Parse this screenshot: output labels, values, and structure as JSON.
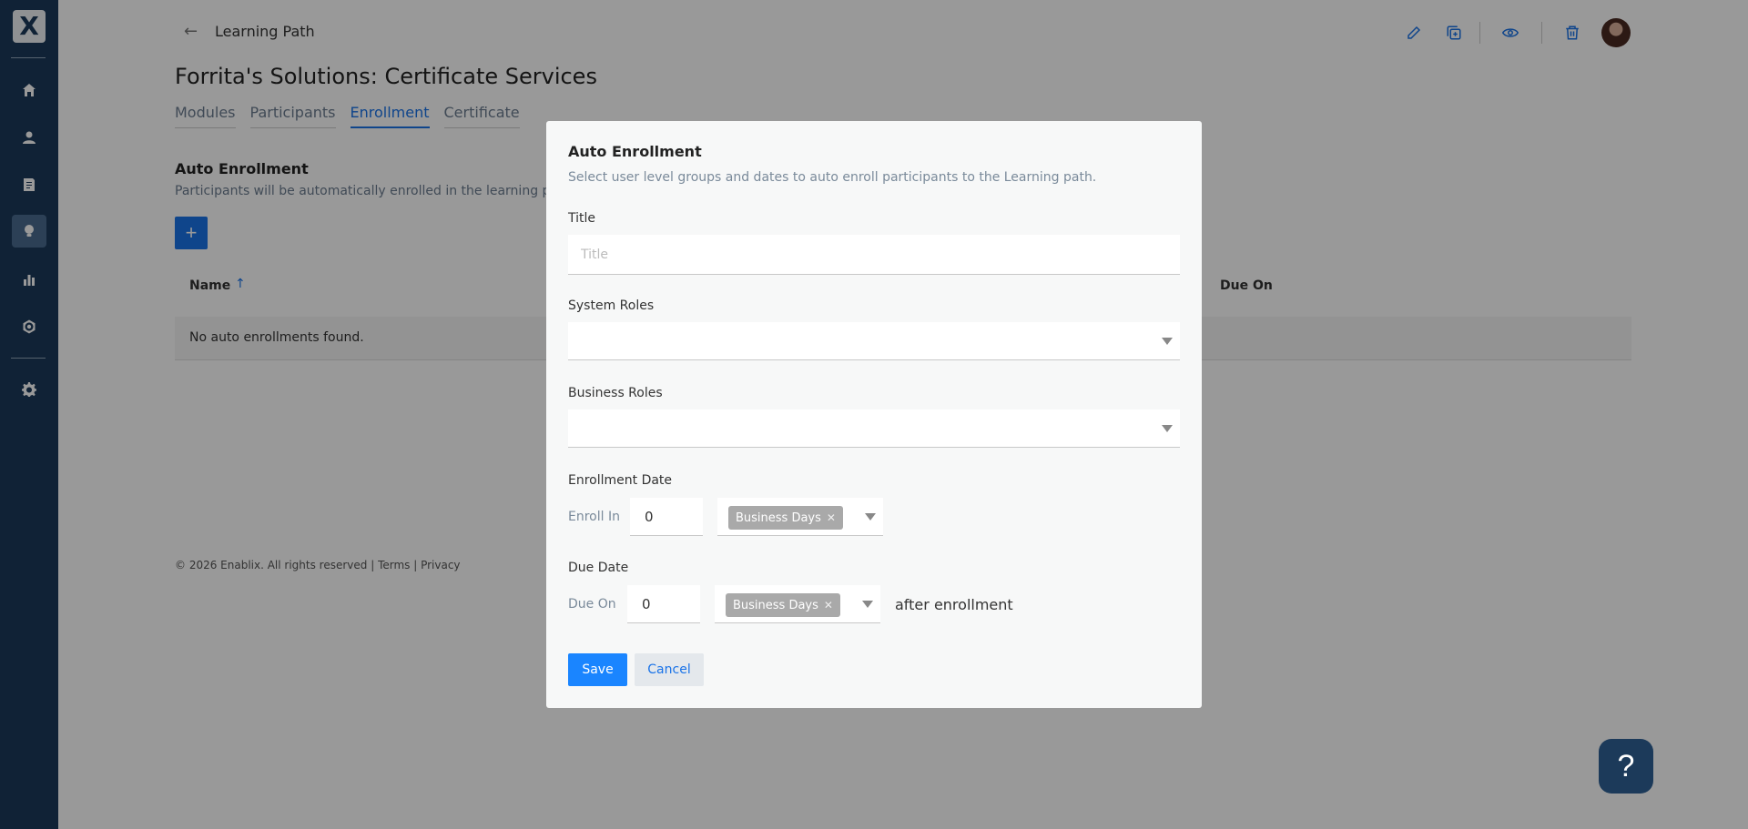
{
  "sidebar": {
    "logo_text": "X",
    "items": [
      {
        "icon": "home-icon"
      },
      {
        "icon": "user-icon"
      },
      {
        "icon": "book-icon"
      },
      {
        "icon": "lightbulb-icon"
      },
      {
        "icon": "bar-chart-icon"
      },
      {
        "icon": "certificate-icon"
      },
      {
        "icon": "gear-icon"
      }
    ],
    "active_index": 3
  },
  "header": {
    "breadcrumb": "Learning Path",
    "title": "Forrita's Solutions: Certificate Services"
  },
  "tabs": [
    {
      "label": "Modules"
    },
    {
      "label": "Participants"
    },
    {
      "label": "Enrollment"
    },
    {
      "label": "Certificate"
    }
  ],
  "active_tab": "Enrollment",
  "section": {
    "title": "Auto Enrollment",
    "description": "Participants will be automatically enrolled in the learning path",
    "add_label": "+"
  },
  "table": {
    "columns": [
      "Name",
      "Due On"
    ],
    "sort_indicator": "↑",
    "empty_text": "No auto enrollments found."
  },
  "footer": {
    "text": "© 2026 Enablix. All rights reserved | Terms | Privacy"
  },
  "modal": {
    "title": "Auto Enrollment",
    "description": "Select user level groups and dates to auto enroll participants to the Learning path.",
    "title_label": "Title",
    "title_placeholder": "Title",
    "title_value": "",
    "system_roles_label": "System Roles",
    "business_roles_label": "Business Roles",
    "enrollment_date_label": "Enrollment Date",
    "enroll_in_label": "Enroll In",
    "enroll_in_value": "0",
    "enroll_unit": "Business Days",
    "due_date_label": "Due Date",
    "due_on_label": "Due On",
    "due_on_value": "0",
    "due_unit": "Business Days",
    "after_text": "after enrollment",
    "save_label": "Save",
    "cancel_label": "Cancel"
  },
  "help": {
    "label": "?"
  },
  "colors": {
    "sidebar": "#1c3a5a",
    "accent": "#1a73e8",
    "save": "#1a85ff"
  }
}
